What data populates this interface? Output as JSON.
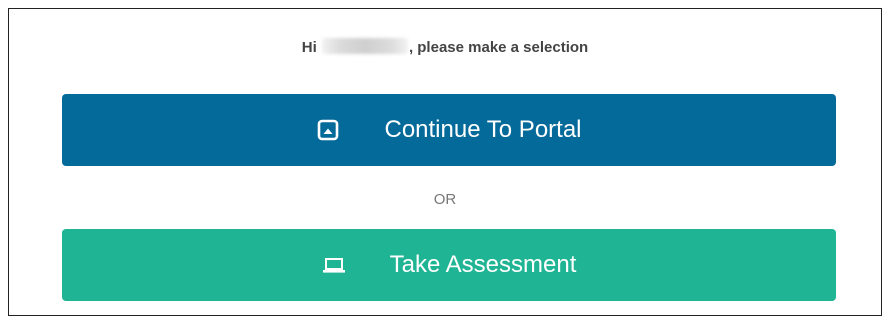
{
  "prompt": {
    "greeting_prefix": "Hi",
    "greeting_suffix": ", please make a selection"
  },
  "actions": {
    "portal": {
      "label": "Continue To Portal",
      "icon": "portal-square-icon",
      "color": "#046a9a"
    },
    "divider_text": "OR",
    "assessment": {
      "label": "Take Assessment",
      "icon": "laptop-icon",
      "color": "#1fb493"
    }
  }
}
